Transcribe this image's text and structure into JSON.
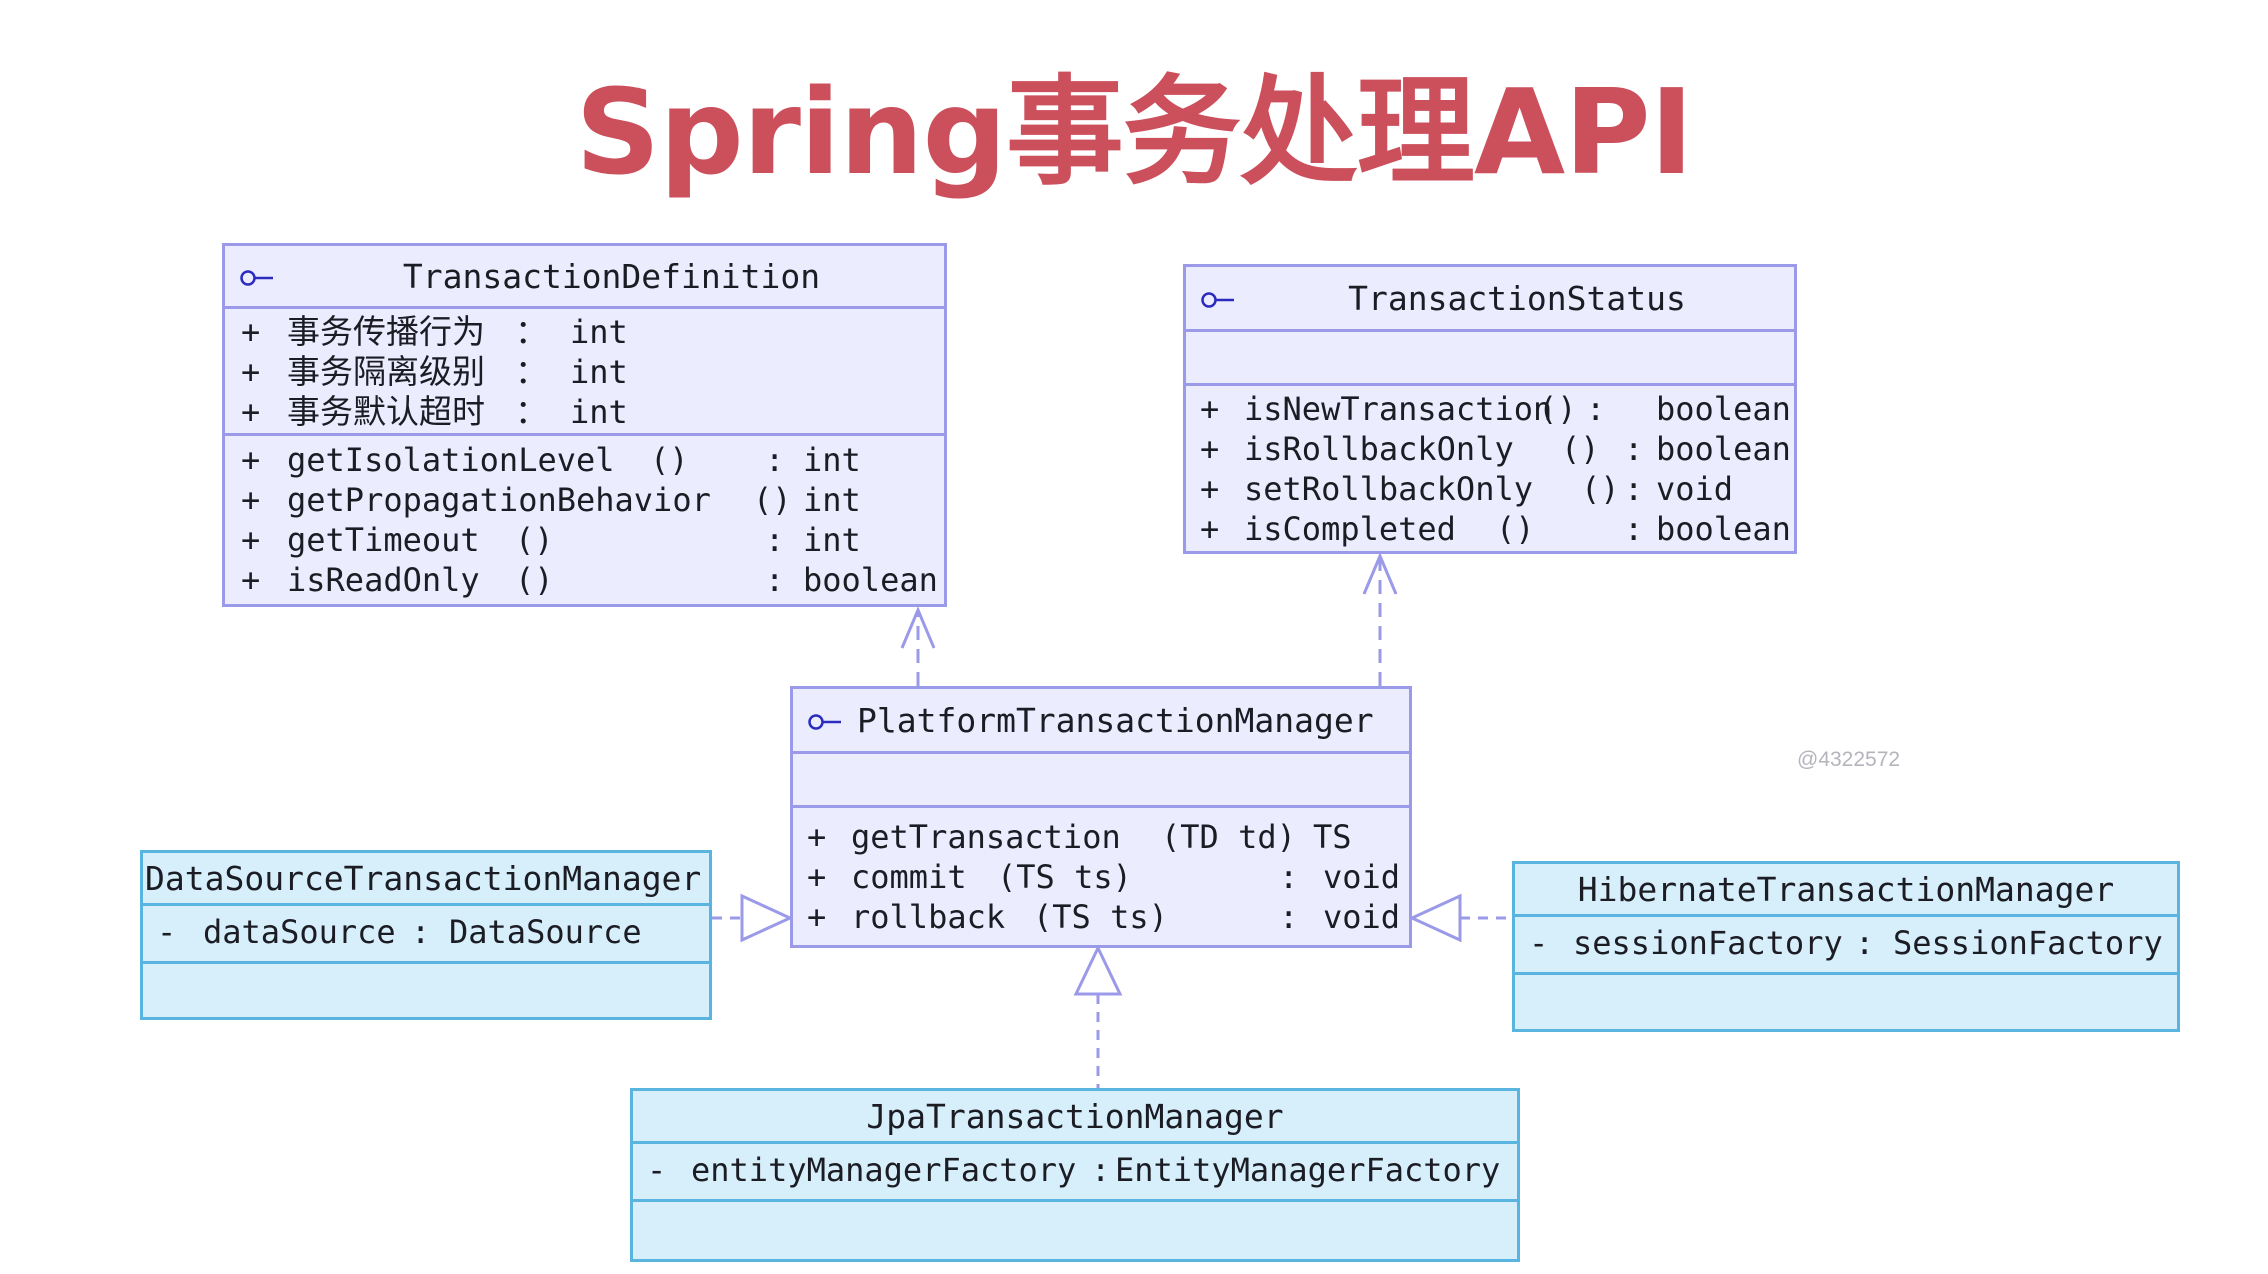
{
  "title": "Spring事务处理API",
  "watermark": "@4322572",
  "colors": {
    "title": "#cc4f5c",
    "interface_fill": "#ececff",
    "interface_border": "#9a9ae8",
    "class_fill": "#d6effb",
    "class_border": "#5ab4e0"
  },
  "icons": {
    "interface": "interface-lollipop-icon"
  },
  "classes": {
    "transaction_definition": {
      "name": "TransactionDefinition",
      "attributes": [
        {
          "vis": "+",
          "label": "事务传播行为",
          "type": "int"
        },
        {
          "vis": "+",
          "label": "事务隔离级别",
          "type": "int"
        },
        {
          "vis": "+",
          "label": "事务默认超时",
          "type": "int"
        }
      ],
      "methods": [
        {
          "vis": "+",
          "name": "getIsolationLevel",
          "params": "()",
          "sep": ":",
          "ret": "int"
        },
        {
          "vis": "+",
          "name": "getPropagationBehavior",
          "params": "()",
          "sep": "",
          "ret": "int"
        },
        {
          "vis": "+",
          "name": "getTimeout",
          "params": "()",
          "sep": ":",
          "ret": "int"
        },
        {
          "vis": "+",
          "name": "isReadOnly",
          "params": "()",
          "sep": ":",
          "ret": "boolean"
        }
      ]
    },
    "transaction_status": {
      "name": "TransactionStatus",
      "methods": [
        {
          "vis": "+",
          "name": "isNewTransaction",
          "params": "()",
          "sep": ":",
          "ret": "boolean"
        },
        {
          "vis": "+",
          "name": "isRollbackOnly",
          "params": "()",
          "sep": ":",
          "ret": "boolean"
        },
        {
          "vis": "+",
          "name": "setRollbackOnly",
          "params": "()",
          "sep": ":",
          "ret": "void"
        },
        {
          "vis": "+",
          "name": "isCompleted",
          "params": "()",
          "sep": ":",
          "ret": "boolean"
        }
      ]
    },
    "platform_transaction_manager": {
      "name": "PlatformTransactionManager",
      "methods": [
        {
          "vis": "+",
          "name": "getTransaction",
          "params": "(TD td)",
          "sep": "",
          "ret": "TS"
        },
        {
          "vis": "+",
          "name": "commit",
          "params": "(TS ts)",
          "sep": ":",
          "ret": "void"
        },
        {
          "vis": "+",
          "name": "rollback",
          "params": "(TS ts)",
          "sep": ":",
          "ret": "void"
        }
      ]
    },
    "datasource_tm": {
      "name": "DataSourceTransactionManager",
      "attribute": {
        "vis": "-",
        "name": "dataSource",
        "sep": ":",
        "type": "DataSource"
      }
    },
    "hibernate_tm": {
      "name": "HibernateTransactionManager",
      "attribute": {
        "vis": "-",
        "name": "sessionFactory",
        "sep": ":",
        "type": "SessionFactory"
      }
    },
    "jpa_tm": {
      "name": "JpaTransactionManager",
      "attribute": {
        "vis": "-",
        "name": "entityManagerFactory",
        "sep": ":",
        "type": "EntityManagerFactory"
      }
    }
  }
}
